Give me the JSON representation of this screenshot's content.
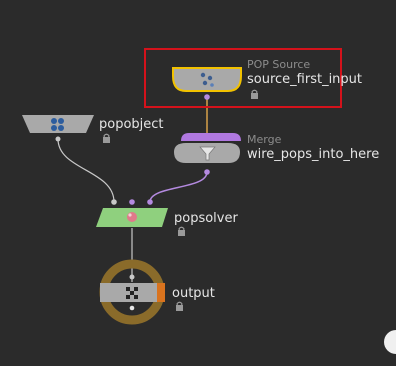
{
  "network": {
    "nodes": {
      "pop_source": {
        "type_label": "POP Source",
        "name": "source_first_input",
        "selected": true
      },
      "popobject": {
        "name": "popobject"
      },
      "merge": {
        "type_label": "Merge",
        "name": "wire_pops_into_here"
      },
      "popsolver": {
        "name": "popsolver"
      },
      "output": {
        "name": "output"
      }
    }
  },
  "colors": {
    "background": "#2b2b2b",
    "node_gray": "#a9a9a9",
    "selection_box": "#d4121b",
    "selected_outline": "#f2c200",
    "solver_green": "#8fd07e",
    "merge_purple": "#b078e0",
    "output_ring": "#8a6b2a",
    "output_flag": "#d9731e",
    "wire_gray": "#c8c8c8",
    "wire_purple": "#b48ae0",
    "wire_orange": "#d8a14a"
  },
  "icons": {
    "pop_source": "points-icon",
    "popobject": "spheres-icon",
    "merge": "funnel-icon",
    "popsolver": "solver-icon",
    "output": "checkered-flag-icon",
    "lock": "lock-icon"
  }
}
